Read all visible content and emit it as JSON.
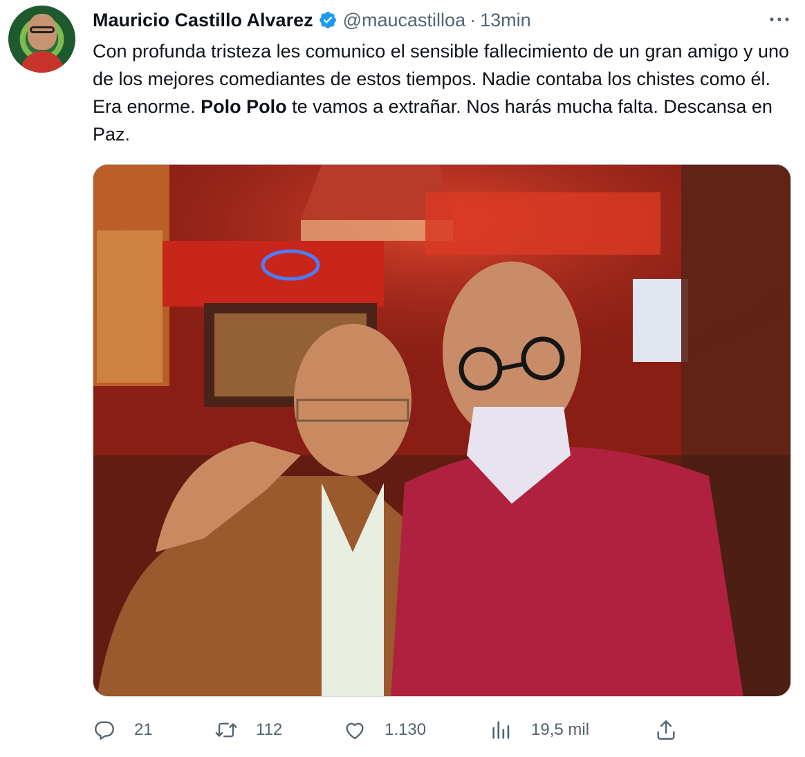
{
  "tweet": {
    "author": {
      "name": "Mauricio Castillo Alvarez",
      "handle": "@maucastilloa",
      "separator": "·",
      "time": "13min"
    },
    "text": {
      "part1": "Con profunda tristeza les comunico el sensible fallecimiento de un gran amigo y uno de los mejores comediantes de estos tiempos. Nadie contaba los chistes como él. Era enorme. ",
      "bold": "Polo Polo",
      "part2": " te vamos a extrañar. Nos harás mucha falta. Descansa en Paz."
    },
    "actions": {
      "replies": "21",
      "retweets": "112",
      "likes": "1.130",
      "views": "19,5 mil"
    }
  },
  "colors": {
    "text": "#0f1419",
    "secondary": "#536471",
    "verified": "#1d9bf0"
  },
  "icons": [
    "verified-badge-icon",
    "more-icon",
    "reply-icon",
    "retweet-icon",
    "like-icon",
    "views-icon",
    "share-icon"
  ]
}
